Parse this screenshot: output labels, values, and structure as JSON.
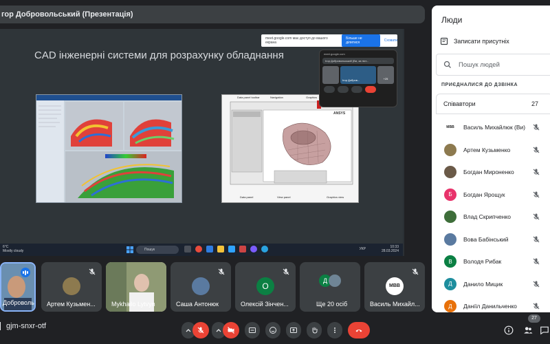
{
  "presenter": {
    "label": "гор Добровольський (Презентація)"
  },
  "slide": {
    "title": "CAD інженерні системи для розрахунку обладнання",
    "share_banner": {
      "text": "meet.google.com має доступ до вашого екрана",
      "stop_label": "Більше не ділитися",
      "hide_label": "Сховати"
    },
    "cad2_labels": {
      "data_panel_toolbar": "Data panel toolbar",
      "navigation": "Navigation",
      "graphics": "Graphics",
      "data_panel": "Data panel",
      "view_panel": "View panel",
      "graphics_view": "Graphics view",
      "ansys": "ANSYS"
    },
    "mini_meet": {
      "url": "meet.google.com",
      "name": "Ігор Добровольський (Ви, за піст...",
      "tile_name": "Ігор Добров...",
      "extra": "+25"
    },
    "taskbar": {
      "weather_temp": "6°C",
      "weather_desc": "Mostly cloudy",
      "search_placeholder": "Пошук",
      "lang": "УКР",
      "time": "10:33",
      "date": "28.03.2024"
    }
  },
  "participants": [
    {
      "name": "Добровольс...",
      "active": true
    },
    {
      "name": "Артем Кузьмен...",
      "muted": true
    },
    {
      "name": "Mykhailo Lytvyn",
      "muted": false
    },
    {
      "name": "Саша Антонюк",
      "muted": true
    },
    {
      "name": "Олексій Зінчен...",
      "initial": "О",
      "muted": true
    },
    {
      "name": "Ще 20 осіб",
      "initial": "Д"
    },
    {
      "name": "Василь Михайл...",
      "logo": "MBB",
      "muted": true
    }
  ],
  "meeting_code": "gjm-snxr-otf",
  "people_count_badge": "27",
  "panel": {
    "title": "Люди",
    "record_label": "Записати присутніх",
    "search_placeholder": "Пошук людей",
    "section_label": "ПРИЄДНАЛИСЯ ДО ДЗВІНКА",
    "collaborators_label": "Співавтори",
    "collaborators_count": "27",
    "people": [
      {
        "name": "Василь Михайлюк (Ви)",
        "avatar": "MBB",
        "color": "#ffffff"
      },
      {
        "name": "Артем Кузьменко",
        "avatar": "photo",
        "color": "#8d7a4f"
      },
      {
        "name": "Богдан Мироненко",
        "avatar": "photo",
        "color": "#6b5a48"
      },
      {
        "name": "Богдан Ярощук",
        "avatar": "Б",
        "color": "#e8336b"
      },
      {
        "name": "Влад Скрипченко",
        "avatar": "photo",
        "color": "#3e6e3a"
      },
      {
        "name": "Вова Бабінський",
        "avatar": "photo",
        "color": "#5a7aa0"
      },
      {
        "name": "Володя Рибак",
        "avatar": "В",
        "color": "#0b8043"
      },
      {
        "name": "Данило Мицик",
        "avatar": "Д",
        "color": "#1e8e9e"
      },
      {
        "name": "Даніїл Данильченко",
        "avatar": "Д",
        "color": "#e8710a"
      }
    ]
  },
  "colors": {
    "accent": "#1a73e8",
    "danger": "#ea4335",
    "background": "#202124",
    "control": "#3c4043"
  }
}
